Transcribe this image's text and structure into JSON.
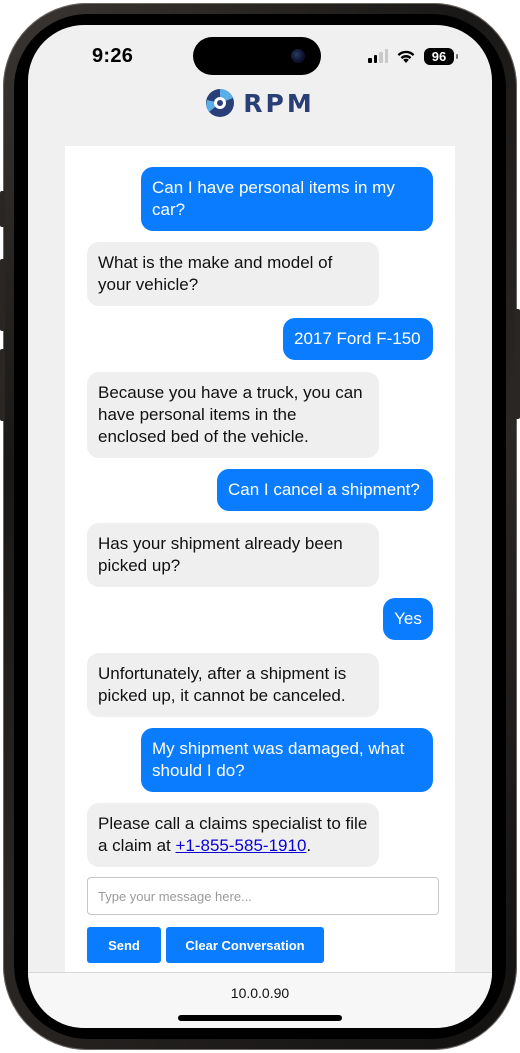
{
  "status": {
    "time": "9:26",
    "battery": "96"
  },
  "brand": {
    "name": "RPM"
  },
  "messages": [
    {
      "from": "user",
      "text": "Can I have personal items in my car?"
    },
    {
      "from": "bot",
      "text": "What is the make and model of your vehicle?"
    },
    {
      "from": "user",
      "text": "2017 Ford F-150"
    },
    {
      "from": "bot",
      "text": "Because you have a truck, you can have personal items in the enclosed bed of the vehicle."
    },
    {
      "from": "user",
      "text": "Can I cancel a shipment?"
    },
    {
      "from": "bot",
      "text": "Has your shipment already been picked up?"
    },
    {
      "from": "user",
      "text": "Yes"
    },
    {
      "from": "bot",
      "text": "Unfortunately, after a shipment is picked up, it cannot be canceled."
    },
    {
      "from": "user",
      "text": "My shipment was damaged, what should I do?"
    },
    {
      "from": "bot",
      "text_before": "Please call a claims specialist to file a claim at ",
      "phone_link": "+1-855-585-1910",
      "text_after": "."
    }
  ],
  "composer": {
    "placeholder": "Type your message here...",
    "value": ""
  },
  "buttons": {
    "send": "Send",
    "clear": "Clear Conversation"
  },
  "browser": {
    "url": "10.0.0.90"
  },
  "colors": {
    "user_bubble": "#0a7cff",
    "bot_bubble": "#efefef",
    "brand": "#2a3f78"
  }
}
